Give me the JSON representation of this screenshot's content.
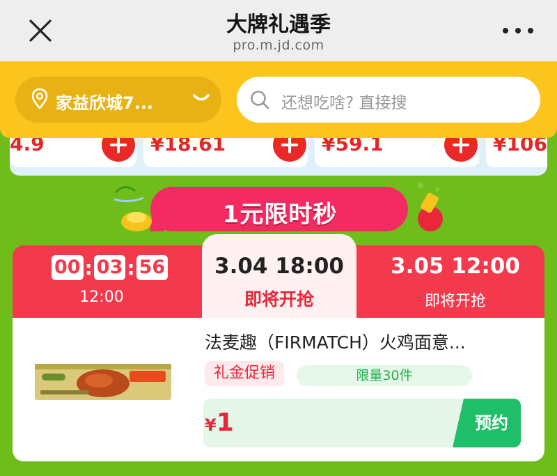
{
  "browser": {
    "title": "大牌礼遇季",
    "url": "pro.m.jd.com",
    "close_icon": "close-icon",
    "more_icon": "more-icon"
  },
  "search_bar": {
    "location": "家益欣城7...",
    "placeholder": "还想吃啥? 直接搜"
  },
  "product_strip": {
    "prices": [
      "4.9",
      "¥18.61",
      "¥59.1",
      "¥106."
    ]
  },
  "flash_sale": {
    "banner_title": "1元限时秒",
    "sessions": [
      {
        "countdown": [
          "00",
          "03",
          "56"
        ],
        "time": "12:00"
      },
      {
        "time": "3.04 18:00",
        "status": "即将开抢"
      },
      {
        "time": "3.05 12:00",
        "status": "即将开抢"
      }
    ]
  },
  "product": {
    "name": "法麦趣（FIRMATCH）火鸡面意...",
    "promo_tag": "礼金促销",
    "limit_tag": "限量30件",
    "currency": "¥",
    "price": "1",
    "action": "预约"
  },
  "colors": {
    "page_bg": "#6ebd1a",
    "header_bg": "#eeeeef",
    "search_bar_bg": "#fbc51e",
    "brand_red": "#f23a4c",
    "price_red": "#e6242e",
    "book_green": "#1fbf69"
  }
}
